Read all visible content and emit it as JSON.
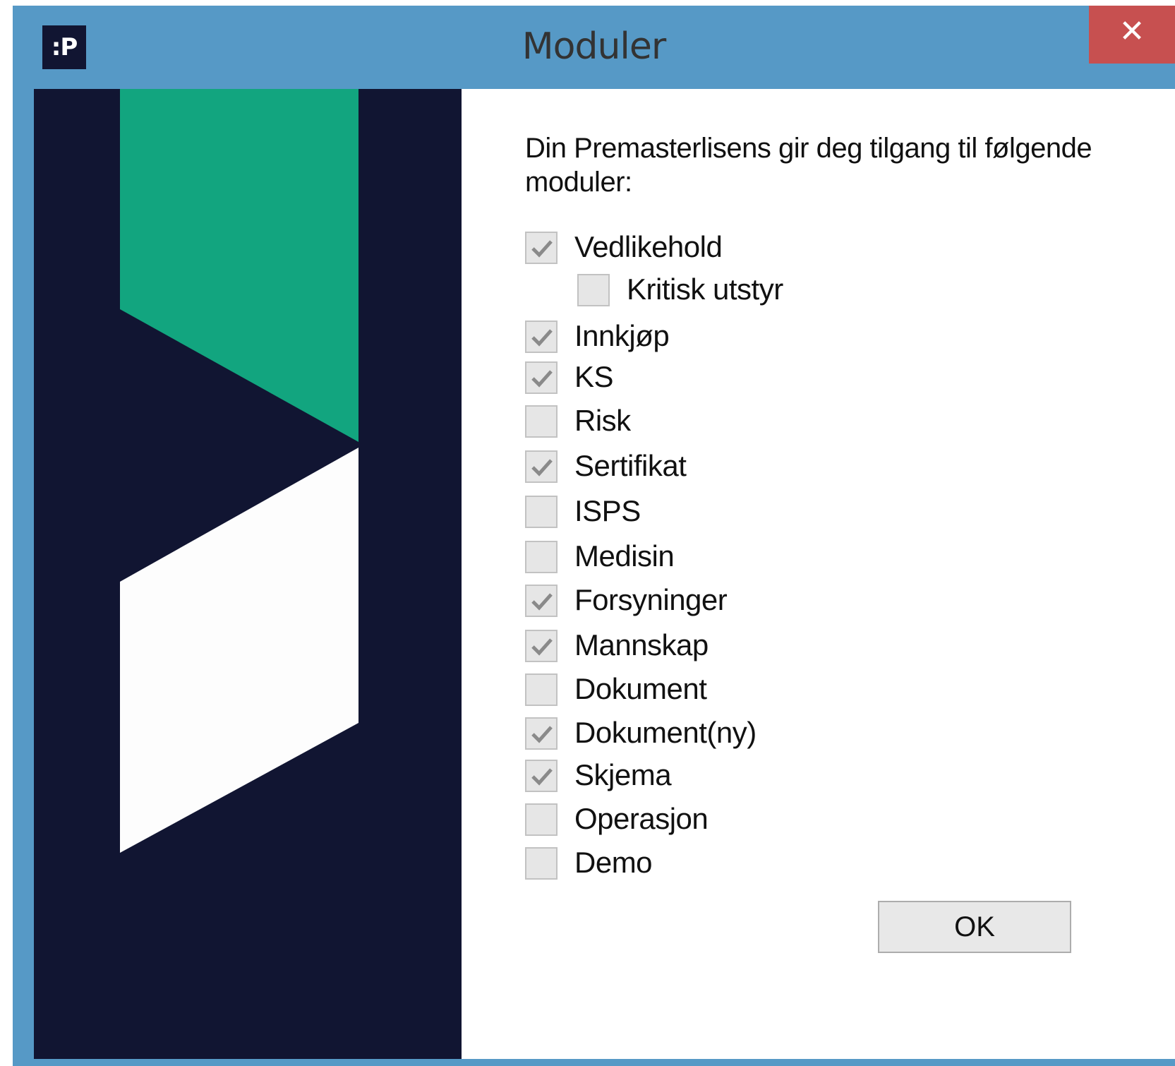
{
  "window": {
    "title": "Moduler",
    "app_icon_text": ":P",
    "close_glyph": "✕"
  },
  "colors": {
    "titlebar": "#5699c6",
    "close": "#c75050",
    "banner_dark": "#111532",
    "banner_green": "#12a57f",
    "banner_white": "#fdfdfd"
  },
  "intro_text": "Din Premasterlisens gir deg tilgang til følgende moduler:",
  "modules": [
    {
      "label": "Vedlikehold",
      "checked": true
    },
    {
      "label": "Kritisk utstyr",
      "checked": false,
      "indent": true
    },
    {
      "label": "Innkjøp",
      "checked": true
    },
    {
      "label": "KS",
      "checked": true
    },
    {
      "label": "Risk",
      "checked": false
    },
    {
      "label": "Sertifikat",
      "checked": true
    },
    {
      "label": "ISPS",
      "checked": false
    },
    {
      "label": "Medisin",
      "checked": false
    },
    {
      "label": "Forsyninger",
      "checked": true
    },
    {
      "label": "Mannskap",
      "checked": true
    },
    {
      "label": "Dokument",
      "checked": false
    },
    {
      "label": "Dokument(ny)",
      "checked": true
    },
    {
      "label": "Skjema",
      "checked": true
    },
    {
      "label": "Operasjon",
      "checked": false
    },
    {
      "label": "Demo",
      "checked": false
    }
  ],
  "ok_label": "OK"
}
